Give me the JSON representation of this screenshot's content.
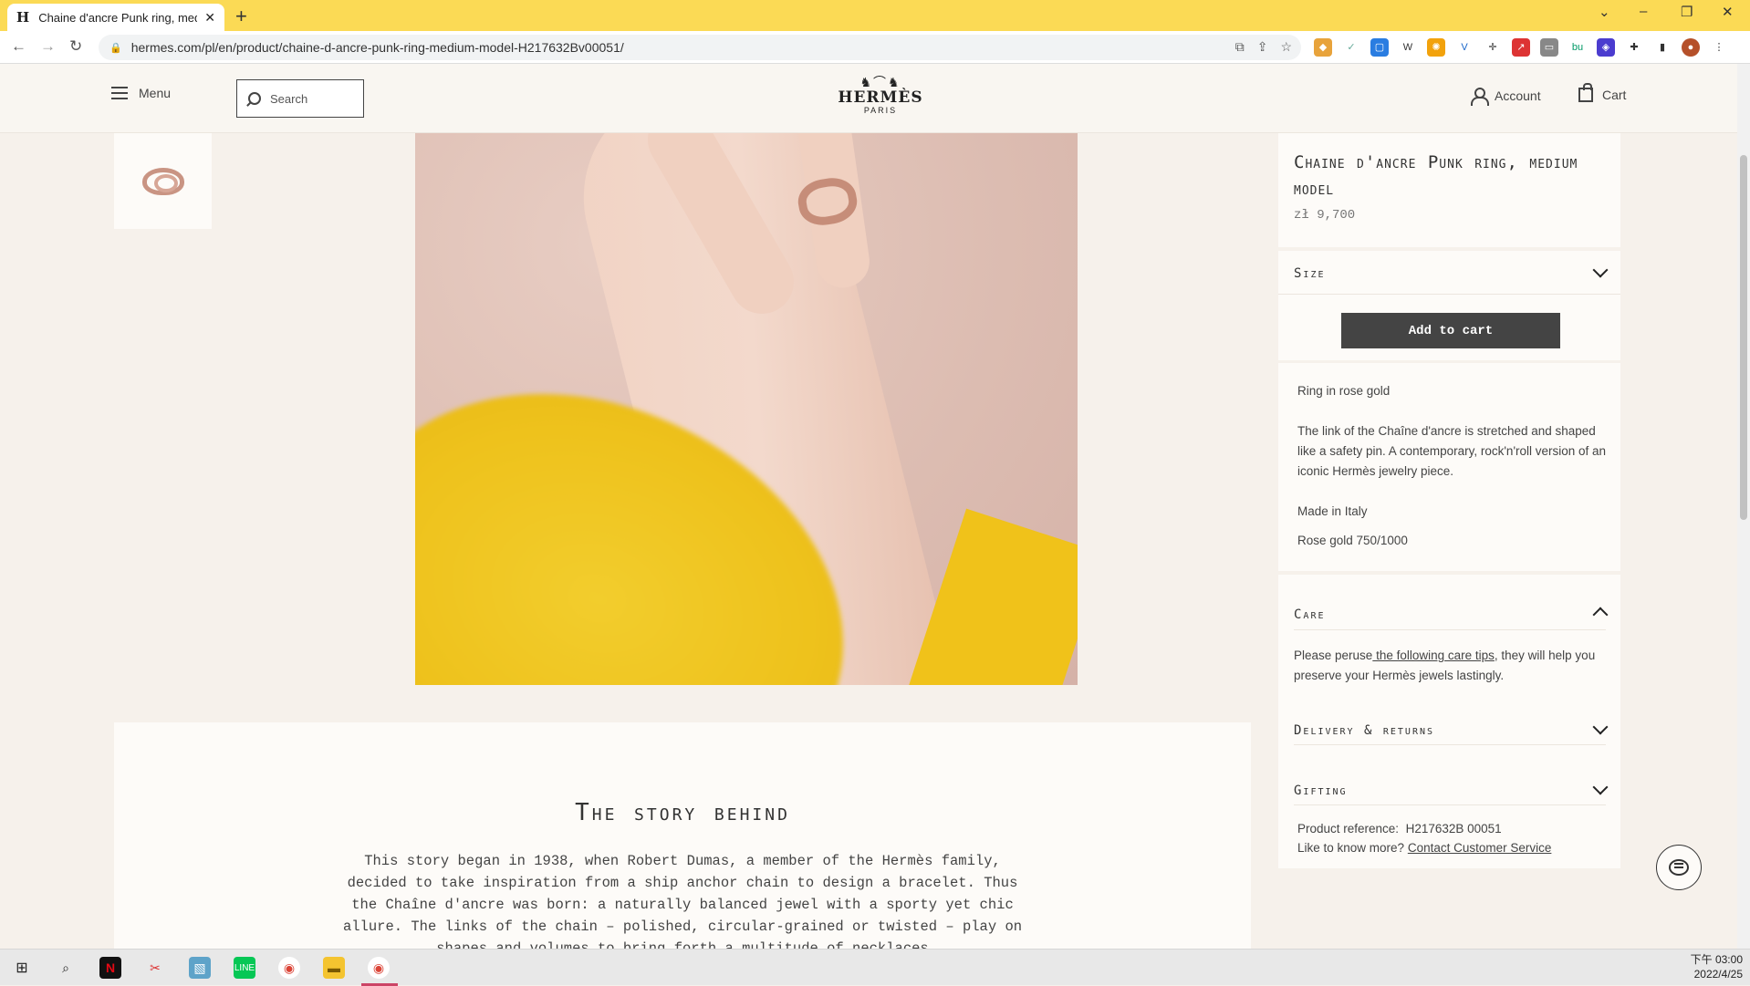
{
  "browser": {
    "tab_title": "Chaine d'ancre Punk ring, med",
    "tab_favicon": "H",
    "url": "hermes.com/pl/en/product/chaine-d-ancre-punk-ring-medium-model-H217632Bv00051/"
  },
  "header": {
    "menu_label": "Menu",
    "search_placeholder": "Search",
    "logo_brand": "HERMÈS",
    "logo_city": "PARIS",
    "account_label": "Account",
    "cart_label": "Cart"
  },
  "product": {
    "title": "Chaine d'ancre Punk ring, medium model",
    "price": "zł 9,700",
    "size_label": "Size",
    "add_to_cart": "Add to cart",
    "material_line": "Ring in rose gold",
    "description": "The link of the Chaîne d'ancre is stretched and shaped like a safety pin. A contemporary, rock'n'roll version of an iconic Hermès jewelry piece.",
    "origin": "Made in Italy",
    "composition": "Rose gold 750/1000"
  },
  "care": {
    "label": "Care",
    "text_before": "Please peruse",
    "link": " the following care tips",
    "text_after": ", they will help you preserve your Hermès jewels lastingly."
  },
  "delivery_label": "Delivery & returns",
  "gifting_label": "Gifting",
  "reference": {
    "label": "Product reference:",
    "value": "H217632B 00051",
    "more_label": "Like to know more?",
    "contact_link": "Contact Customer Service"
  },
  "story": {
    "heading": "The story behind",
    "body": "This story began in 1938, when Robert Dumas, a member of the Hermès family, decided to take inspiration from a ship anchor chain to design a bracelet. Thus the Chaîne d'ancre was born: a naturally balanced jewel with a sporty yet chic allure. The links of the chain – polished, circular-grained or twisted – play on shapes and volumes to bring forth a multitude of necklaces"
  },
  "taskbar": {
    "time": "下午 03:00",
    "date": "2022/4/25"
  },
  "colors": {
    "tabbar": "#fbda55",
    "page_bg": "#f6f1eb",
    "button": "#444444",
    "sleeve_yellow": "#f0c21a"
  }
}
